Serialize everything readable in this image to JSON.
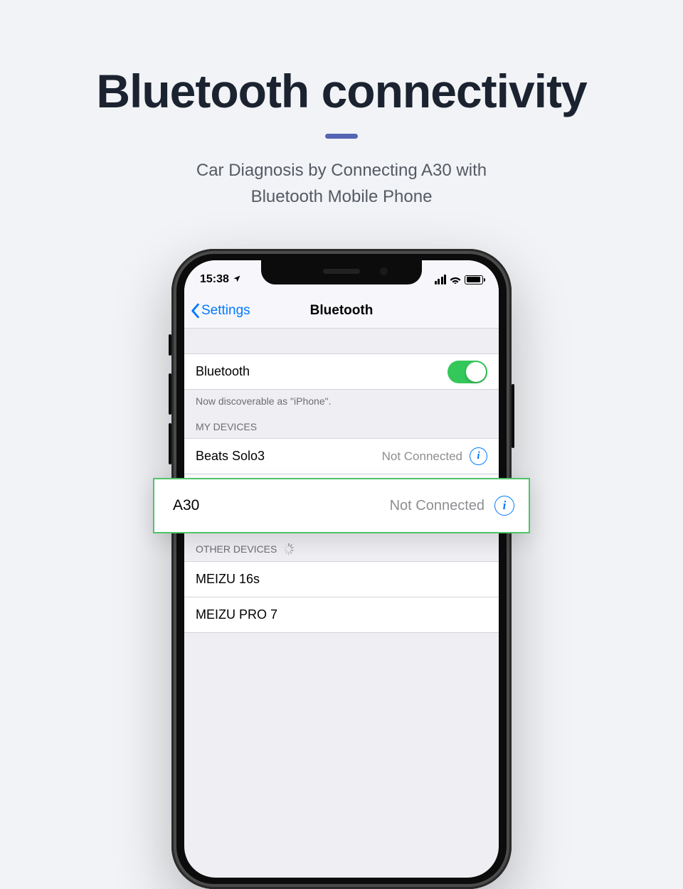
{
  "hero": {
    "title": "Bluetooth connectivity",
    "subtitle_line1": "Car Diagnosis by Connecting A30 with",
    "subtitle_line2": "Bluetooth Mobile Phone"
  },
  "statusbar": {
    "time": "15:38"
  },
  "navbar": {
    "back_label": "Settings",
    "title": "Bluetooth"
  },
  "bluetooth_row": {
    "label": "Bluetooth",
    "enabled": true
  },
  "discoverable_hint": "Now discoverable as \"iPhone\".",
  "sections": {
    "my_devices_header": "MY DEVICES",
    "other_devices_header": "OTHER DEVICES"
  },
  "my_devices": [
    {
      "name": "Beats Solo3",
      "status": "Not Connected"
    },
    {
      "name": "A30",
      "status": "Not Connected"
    }
  ],
  "other_devices": [
    {
      "name": "MEIZU 16s"
    },
    {
      "name": "MEIZU PRO 7"
    }
  ],
  "callout": {
    "name": "A30",
    "status": "Not Connected"
  },
  "colors": {
    "accent_blue": "#007aff",
    "toggle_green": "#34c759",
    "highlight_green": "#4fc469",
    "divider_purple": "#5565b3"
  }
}
